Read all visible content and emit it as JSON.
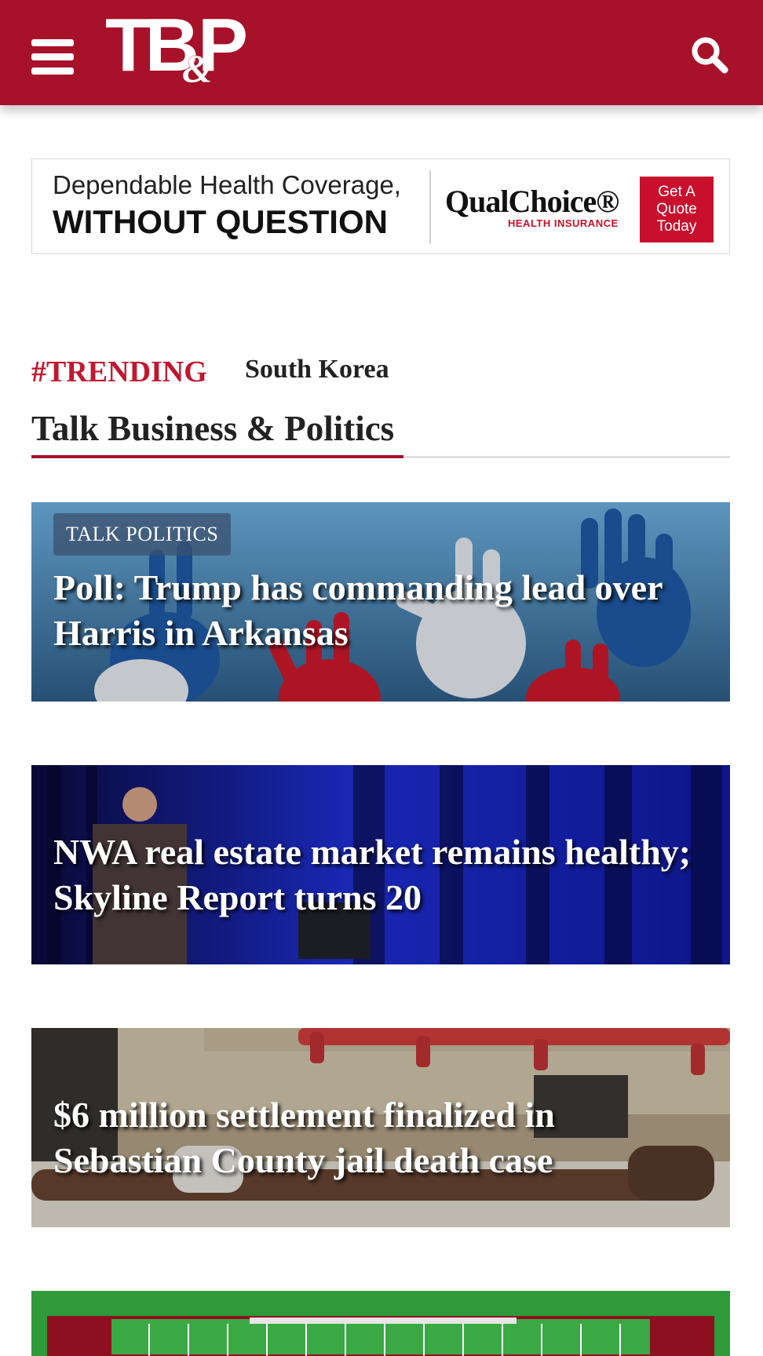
{
  "header": {
    "logo_text": "TB&P",
    "logo_part1": "TB",
    "logo_amp": "&",
    "logo_part2": "P"
  },
  "ad": {
    "line1": "Dependable Health Coverage,",
    "line2": "WITHOUT QUESTION",
    "brand": "QualChoice®",
    "brand_sub": "HEALTH INSURANCE",
    "cta": "Get A\nQuote\nToday"
  },
  "trending": {
    "label": "#TRENDING",
    "items": [
      "South Korea"
    ]
  },
  "section": {
    "title": "Talk Business & Politics"
  },
  "articles": [
    {
      "category": "TALK POLITICS",
      "headline": "Poll: Trump has commanding lead over Harris in Arkansas"
    },
    {
      "category": "",
      "headline": "NWA real estate market remains healthy; Skyline Report turns 20"
    },
    {
      "category": "",
      "headline": "$6 million settlement finalized in Sebastian County jail death case"
    }
  ],
  "colors": {
    "brand_red": "#a8112a",
    "trending_red": "#c0182f",
    "ad_red": "#c8102e"
  }
}
